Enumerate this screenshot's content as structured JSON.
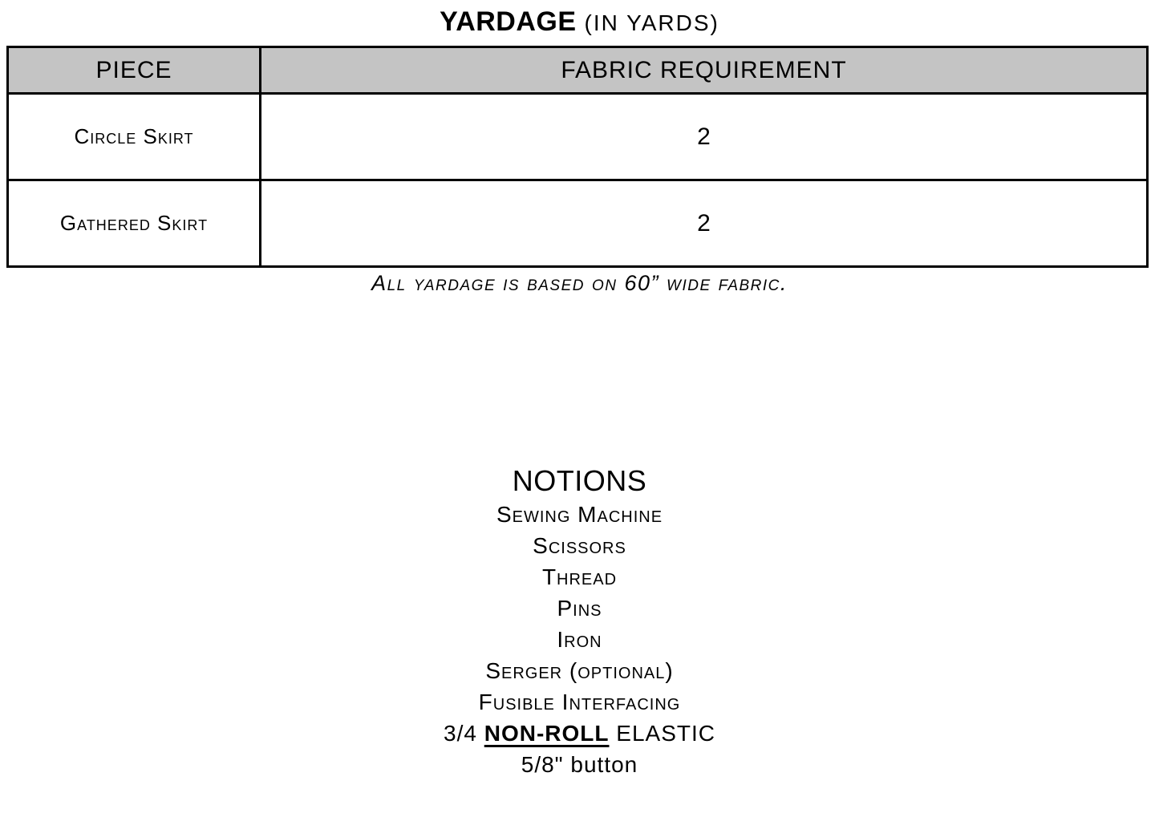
{
  "title": {
    "main": "YARDAGE",
    "sub": "(IN YARDS)"
  },
  "yardage_table": {
    "headers": [
      "PIECE",
      "FABRIC REQUIREMENT"
    ],
    "rows": [
      {
        "piece": "Circle Skirt",
        "fabric_requirement": "2"
      },
      {
        "piece": "Gathered Skirt",
        "fabric_requirement": "2"
      }
    ],
    "header_background": "#c4c4c4",
    "border_color": "#000000"
  },
  "yardage_note": "All yardage is based on 60” wide fabric.",
  "notions": {
    "heading": "NOTIONS",
    "items": [
      {
        "text": "Sewing Machine"
      },
      {
        "text": "Scissors"
      },
      {
        "text": "Thread"
      },
      {
        "text": "Pins"
      },
      {
        "text": "Iron"
      },
      {
        "text": "Serger (optional)"
      },
      {
        "text": "Fusible Interfacing"
      },
      {
        "prefix": "3/4 ",
        "emphasis": "NON-ROLL",
        "suffix": " ELASTIC"
      },
      {
        "text": "5/8\" button"
      }
    ]
  }
}
